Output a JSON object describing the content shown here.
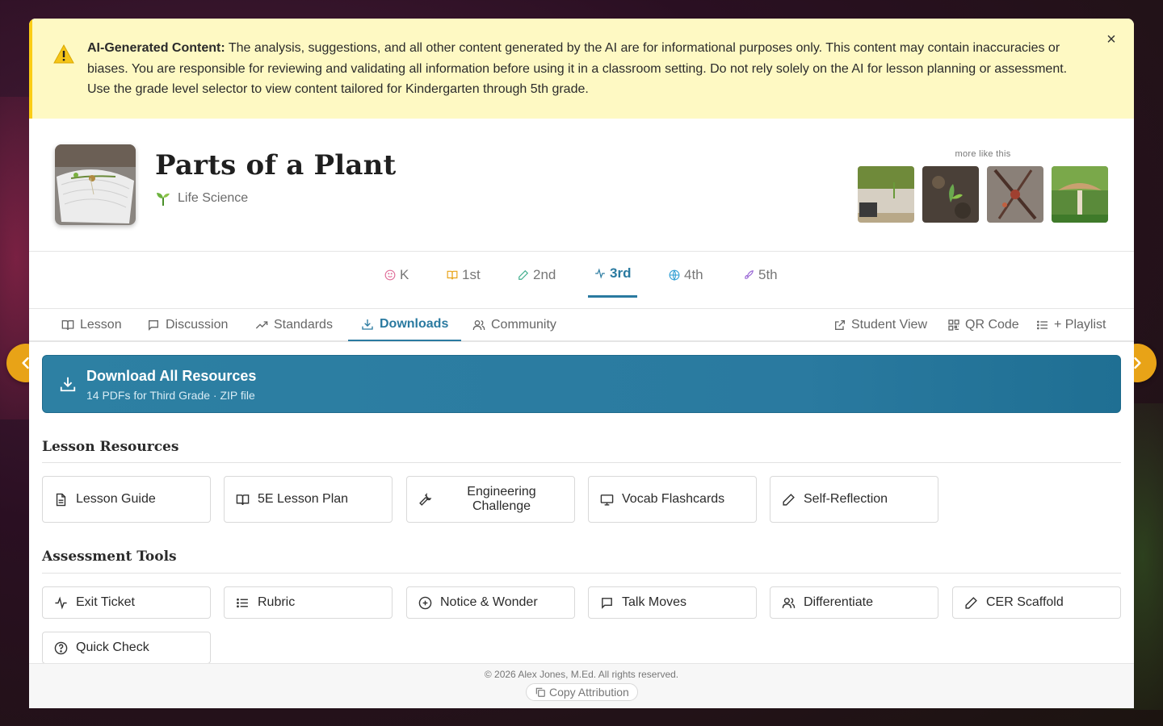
{
  "warning": {
    "label": "AI-Generated Content:",
    "text": " The analysis, suggestions, and all other content generated by the AI are for informational purposes only. This content may contain inaccuracies or biases. You are responsible for reviewing and validating all information before using it in a classroom setting. Do not rely solely on the AI for lesson planning or assessment. Use the grade level selector to view content tailored for Kindergarten through 5th grade.",
    "close": "×"
  },
  "header": {
    "title": "Parts of a Plant",
    "subject": "Life Science",
    "more_label": "more like this"
  },
  "grades": [
    {
      "label": "K",
      "icon": "smile-icon",
      "color": "#e0709a"
    },
    {
      "label": "1st",
      "icon": "book-icon",
      "color": "#e8a317"
    },
    {
      "label": "2nd",
      "icon": "pencil-icon",
      "color": "#3fae8c"
    },
    {
      "label": "3rd",
      "icon": "activity-icon",
      "color": "#2a7aa0"
    },
    {
      "label": "4th",
      "icon": "globe-icon",
      "color": "#3aa3d6"
    },
    {
      "label": "5th",
      "icon": "rocket-icon",
      "color": "#9b6ad6"
    }
  ],
  "active_grade": "3rd",
  "tabs": [
    {
      "label": "Lesson",
      "icon": "book-open-icon"
    },
    {
      "label": "Discussion",
      "icon": "message-icon"
    },
    {
      "label": "Standards",
      "icon": "trending-up-icon"
    },
    {
      "label": "Downloads",
      "icon": "download-icon"
    },
    {
      "label": "Community",
      "icon": "users-icon"
    }
  ],
  "active_tab": "Downloads",
  "actions": [
    {
      "label": "Student View",
      "icon": "external-link-icon"
    },
    {
      "label": "QR Code",
      "icon": "qr-code-icon"
    },
    {
      "label": "+ Playlist",
      "icon": "list-icon"
    }
  ],
  "download_all": {
    "title": "Download All Resources",
    "subtitle": "14 PDFs for Third Grade · ZIP file"
  },
  "lesson_resources": {
    "title": "Lesson Resources",
    "items": [
      "Lesson Guide",
      "5E Lesson Plan",
      "Engineering Challenge",
      "Vocab Flashcards",
      "Self-Reflection"
    ]
  },
  "assessment_tools": {
    "title": "Assessment Tools",
    "items": [
      "Exit Ticket",
      "Rubric",
      "Notice & Wonder",
      "Talk Moves",
      "Differentiate",
      "CER Scaffold",
      "Quick Check"
    ]
  },
  "footer": {
    "copyright": "© 2026 Alex Jones, M.Ed. All rights reserved.",
    "attribution": "Copy Attribution"
  },
  "colors": {
    "accent": "#2a7aa0",
    "warning_bg": "#fef9c3",
    "nav_arrow": "#e8a317"
  }
}
